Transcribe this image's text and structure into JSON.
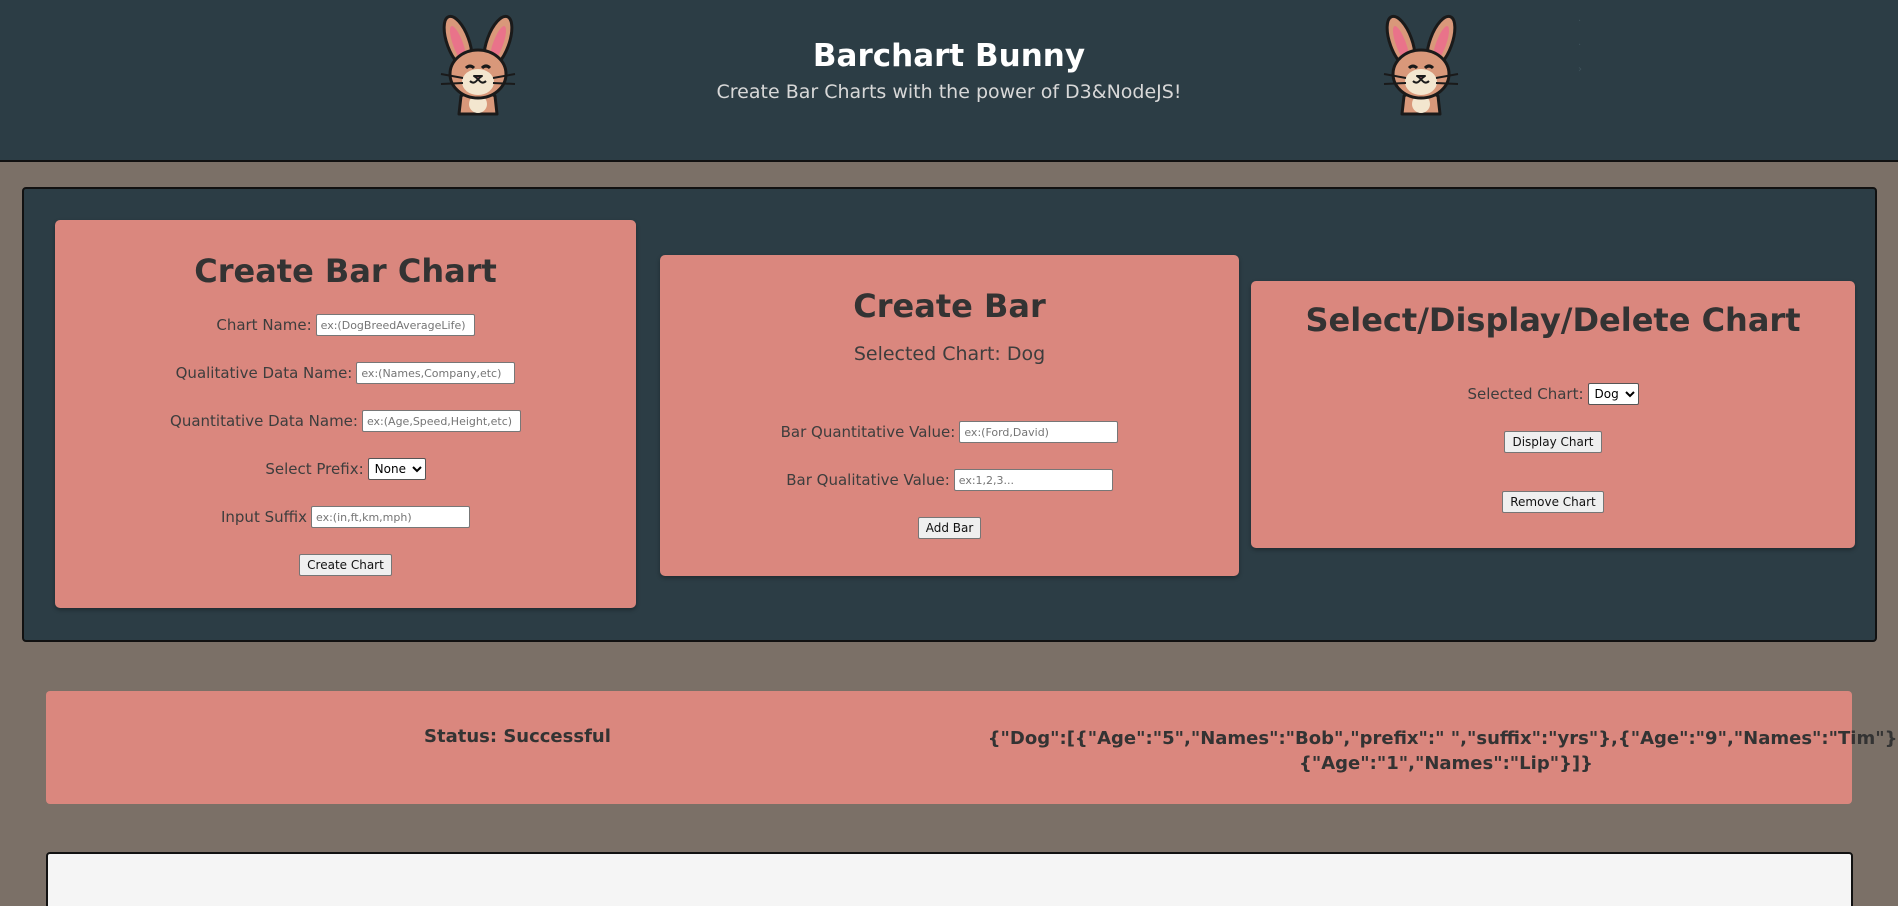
{
  "header": {
    "title": "Barchart Bunny",
    "subtitle": "Create Bar Charts with the power of D3&NodeJS!"
  },
  "create_chart": {
    "heading": "Create Bar Chart",
    "chart_name_label": "Chart Name:",
    "chart_name_placeholder": "ex:(DogBreedAverageLife)",
    "qualitative_label": "Qualitative Data Name:",
    "qualitative_placeholder": "ex:(Names,Company,etc)",
    "quantitative_label": "Quantitative Data Name:",
    "quantitative_placeholder": "ex:(Age,Speed,Height,etc)",
    "prefix_label": "Select Prefix:",
    "prefix_selected": "None",
    "suffix_label": "Input Suffix",
    "suffix_placeholder": "ex:(in,ft,km,mph)",
    "button": "Create Chart"
  },
  "create_bar": {
    "heading": "Create Bar",
    "selected_chart": "Selected Chart: Dog",
    "quantitative_label": "Bar Quantitative Value:",
    "quantitative_placeholder": "ex:(Ford,David)",
    "qualitative_label": "Bar Qualitative Value:",
    "qualitative_placeholder": "ex:1,2,3...",
    "button": "Add Bar"
  },
  "select_chart": {
    "heading": "Select/Display/Delete Chart",
    "selected_label": "Selected Chart:",
    "selected_value": "Dog",
    "display_button": "Display Chart",
    "remove_button": "Remove Chart"
  },
  "status": {
    "label": "Status: Successful",
    "json_line1": "{\"Dog\":[{\"Age\":\"5\",\"Names\":\"Bob\",\"prefix\":\" \",\"suffix\":\"yrs\"},{\"Age\":\"9\",\"Names\":\"Tim\"},",
    "json_line2": "{\"Age\":\"1\",\"Names\":\"Lip\"}]}"
  },
  "icons": {
    "logo_left": "bunny-icon",
    "logo_right": "bunny-icon"
  },
  "colors": {
    "header_bg": "#2c3d45",
    "page_bg": "#7b7067",
    "card_bg": "#da877e",
    "chart_area_bg": "#f5f5f5"
  }
}
